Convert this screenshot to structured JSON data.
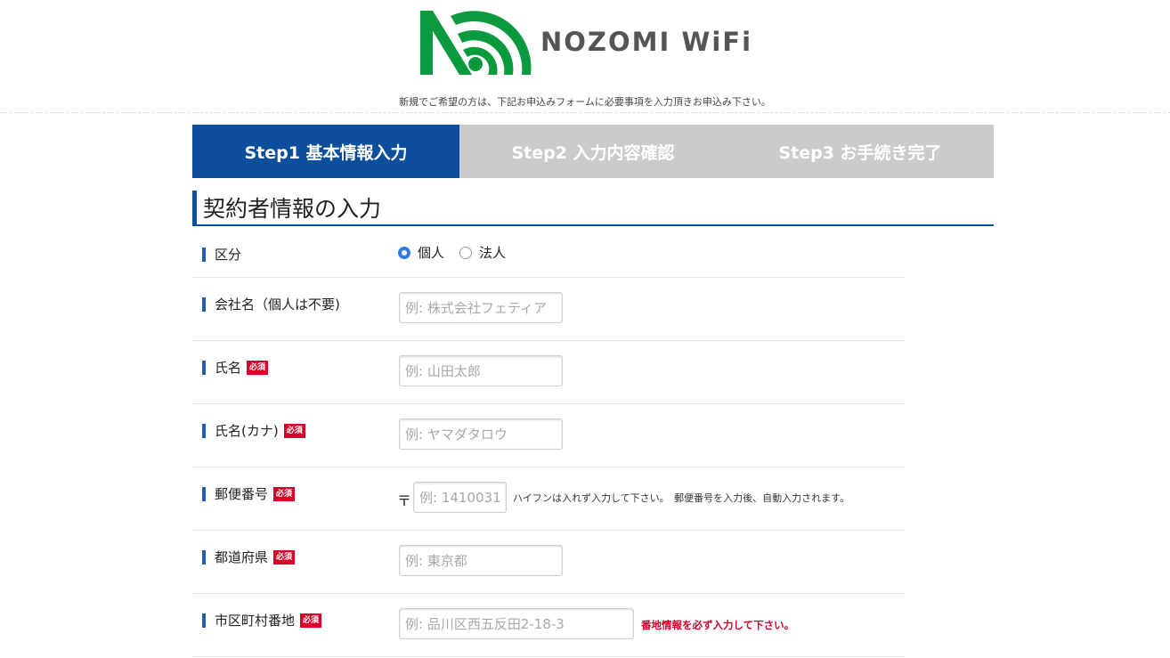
{
  "brand": {
    "name": "NOZOMI WiFi",
    "colors": {
      "logo_green": "#0a9a3e",
      "accent_blue": "#0d4f9c",
      "required_red": "#d8002a"
    }
  },
  "notice": "新規でご希望の方は、下記お申込みフォームに必要事項を入力頂きお申込み下さい。",
  "steps": [
    {
      "label": "Step1 基本情報入力",
      "active": true
    },
    {
      "label": "Step2 入力内容確認",
      "active": false
    },
    {
      "label": "Step3 お手続き完了",
      "active": false
    }
  ],
  "section_title": "契約者情報の入力",
  "required_badge": "必須",
  "fields": {
    "type": {
      "label": "区分",
      "options": [
        "個人",
        "法人"
      ],
      "selected": "個人"
    },
    "company": {
      "label": "会社名（個人は不要)",
      "placeholder": "例: 株式会社フェティア"
    },
    "name": {
      "label": "氏名",
      "placeholder": "例: 山田太郎"
    },
    "kana": {
      "label": "氏名(カナ)",
      "placeholder": "例: ヤマダタロウ"
    },
    "postal": {
      "label": "郵便番号",
      "prefix": "〒",
      "placeholder": "例: 1410031",
      "hint": "ハイフンは入れず入力して下さい。　郵便番号を入力後、自動入力されます。"
    },
    "prefecture": {
      "label": "都道府県",
      "placeholder": "例: 東京都"
    },
    "address": {
      "label": "市区町村番地",
      "placeholder": "例: 品川区西五反田2-18-3",
      "warning": "番地情報を必ず入力して下さい。"
    }
  }
}
